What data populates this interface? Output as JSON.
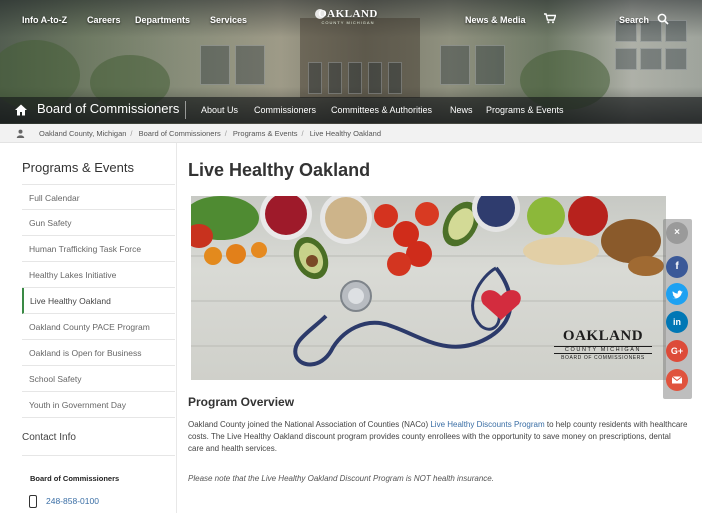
{
  "topnav": {
    "info": "Info A-to-Z",
    "careers": "Careers",
    "departments": "Departments",
    "services": "Services",
    "logo_text": "OAKLAND",
    "logo_sub": "COUNTY MICHIGAN",
    "news": "News & Media",
    "search": "Search"
  },
  "board": {
    "title": "Board of Commissioners",
    "subnav": [
      "About Us",
      "Commissioners",
      "Committees & Authorities",
      "News",
      "Programs & Events"
    ]
  },
  "breadcrumb": [
    "Oakland County, Michigan",
    "Board of Commissioners",
    "Programs & Events",
    "Live Healthy Oakland"
  ],
  "sidebar": {
    "title": "Programs & Events",
    "items": [
      {
        "label": "Full Calendar"
      },
      {
        "label": "Gun Safety"
      },
      {
        "label": "Human Trafficking Task Force"
      },
      {
        "label": "Healthy Lakes Initiative"
      },
      {
        "label": "Live Healthy Oakland"
      },
      {
        "label": "Oakland County PACE Program"
      },
      {
        "label": "Oakland is Open for Business"
      },
      {
        "label": "School Safety"
      },
      {
        "label": "Youth in Government Day"
      }
    ],
    "active_index": 4,
    "contact": "Contact Info",
    "board_label": "Board of Commissioners",
    "phone": "248-858-0100"
  },
  "main": {
    "title": "Live Healthy Oakland",
    "banner": {
      "logo_main": "OAKLAND",
      "logo_sub": "COUNTY MICHIGAN",
      "logo_sub2": "BOARD OF COMMISSIONERS"
    },
    "overview_title": "Program Overview",
    "para_before": "Oakland County joined the National Association of Counties (NACo) ",
    "para_link": "Live Healthy Discounts Program",
    "para_after": " to help county residents with healthcare costs. The Live Healthy Oakland discount program provides county enrollees with the opportunity to save money on prescriptions, dental care and health services.",
    "note": "Please note that the Live Healthy Oakland Discount Program is NOT health insurance."
  },
  "social": {
    "close": "×",
    "facebook": "f",
    "linkedin": "in",
    "google": "G+"
  },
  "colors": {
    "accent_green": "#3a8a45",
    "link_blue": "#3a6ea5",
    "facebook": "#3b5998",
    "twitter": "#1da1f2",
    "linkedin": "#0077b5",
    "google": "#dd4b39",
    "email": "#e0533d"
  }
}
